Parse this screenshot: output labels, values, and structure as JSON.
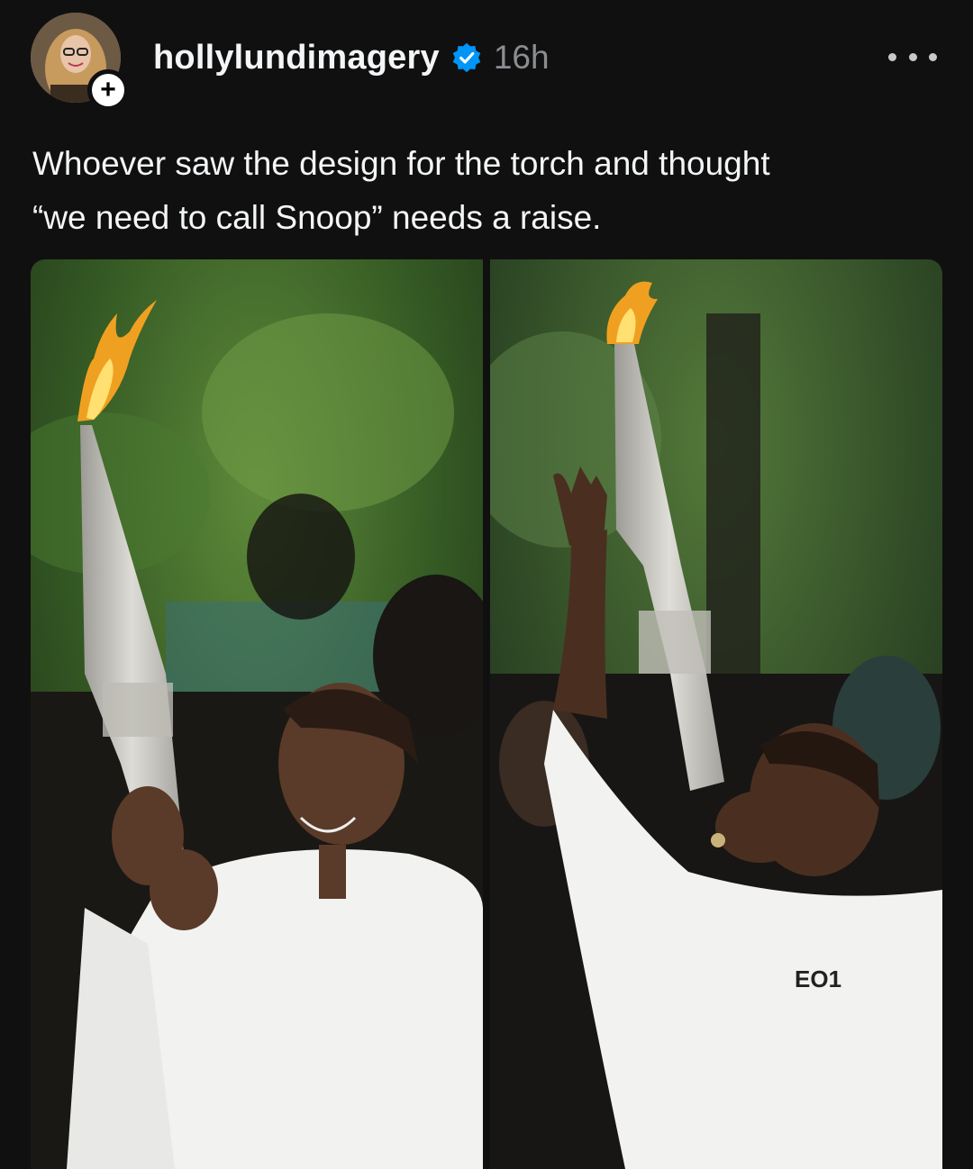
{
  "post": {
    "username": "hollylundimagery",
    "timestamp": "16h",
    "follow_icon": "plus-icon",
    "verified_icon": "verified-badge-icon",
    "more_icon": "more-options-icon",
    "text_lines": [
      "Whoever saw the design for the torch and thought",
      "“we need to call Snoop” needs a raise."
    ]
  },
  "media": {
    "images": [
      {
        "name": "photo-left"
      },
      {
        "name": "photo-right",
        "shirt_text": "EO1"
      }
    ]
  },
  "colors": {
    "background": "#101010",
    "text": "#f3f5f7",
    "muted": "#8a8d91",
    "verified": "#0095f6"
  }
}
